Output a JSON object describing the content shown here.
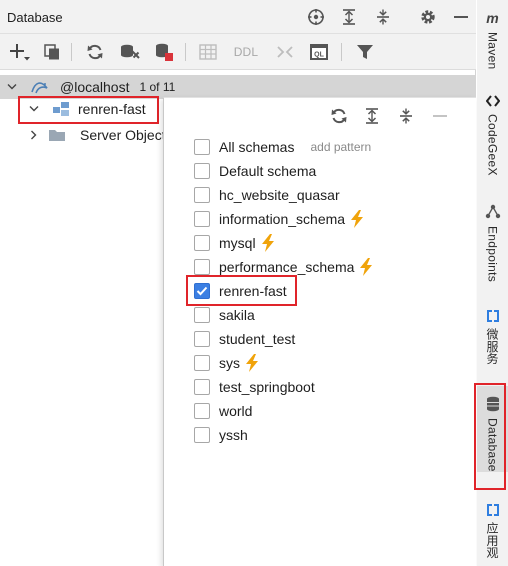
{
  "panel": {
    "title": "Database"
  },
  "toolbar": {
    "ddl_label": "DDL"
  },
  "tree": {
    "host_label": "@localhost",
    "host_count": "1 of 11",
    "selected_db": "renren-fast",
    "server_objects": "Server Objects"
  },
  "popup": {
    "all_schemas": "All schemas",
    "add_pattern": "add pattern",
    "schemas": [
      {
        "name": "Default schema",
        "checked": false,
        "bolt": false
      },
      {
        "name": "hc_website_quasar",
        "checked": false,
        "bolt": false
      },
      {
        "name": "information_schema",
        "checked": false,
        "bolt": true
      },
      {
        "name": "mysql",
        "checked": false,
        "bolt": true
      },
      {
        "name": "performance_schema",
        "checked": false,
        "bolt": true
      },
      {
        "name": "renren-fast",
        "checked": true,
        "bolt": false
      },
      {
        "name": "sakila",
        "checked": false,
        "bolt": false
      },
      {
        "name": "student_test",
        "checked": false,
        "bolt": false
      },
      {
        "name": "sys",
        "checked": false,
        "bolt": true
      },
      {
        "name": "test_springboot",
        "checked": false,
        "bolt": false
      },
      {
        "name": "world",
        "checked": false,
        "bolt": false
      },
      {
        "name": "yssh",
        "checked": false,
        "bolt": false
      }
    ]
  },
  "strip": {
    "maven": "Maven",
    "maven_logo": "m",
    "codegeex": "CodeGeeX",
    "endpoints": "Endpoints",
    "microservices": "微服务",
    "database": "Database",
    "applications": "应用观"
  },
  "colors": {
    "accent": "#3b7fe3",
    "highlight": "#e0242a",
    "bolt": "#f0a30a",
    "selection": "#d5d5d5"
  },
  "icons": [
    "add-icon",
    "duplicate-icon",
    "refresh-icon",
    "data-sources-icon",
    "stop-icon",
    "table-icon",
    "compare-icon",
    "query-console-icon",
    "filter-icon",
    "crosshair-icon",
    "expand-all-icon",
    "collapse-all-icon",
    "gear-icon",
    "minimize-icon"
  ]
}
